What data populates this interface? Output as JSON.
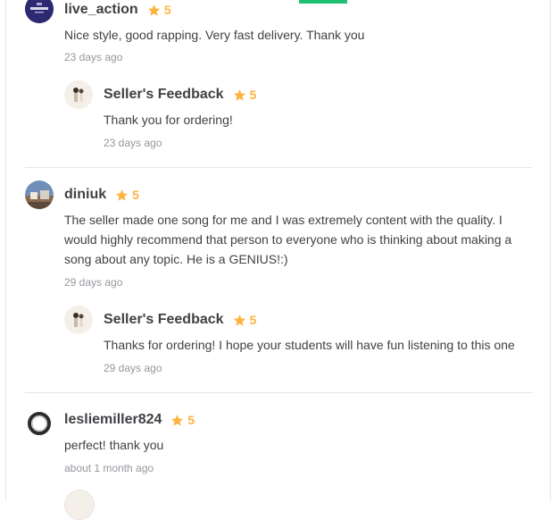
{
  "reviews": [
    {
      "username": "live_action",
      "avatar_text": "LIVE ACTION",
      "rating": "5",
      "text": "Nice style, good rapping. Very fast delivery. Thank you",
      "date": "23 days ago",
      "reply": {
        "title": "Seller's Feedback",
        "rating": "5",
        "text": "Thank you for ordering!",
        "date": "23 days ago"
      }
    },
    {
      "username": "diniuk",
      "rating": "5",
      "text": "The seller made one song for me and I was extremely content with the quality. I would highly recommend that person to everyone who is thinking about making a song about any topic. He is a GENIUS!:)",
      "date": "29 days ago",
      "reply": {
        "title": "Seller's Feedback",
        "rating": "5",
        "text": "Thanks for ordering! I hope your students will have fun listening to this one",
        "date": "29 days ago"
      }
    },
    {
      "username": "lesliemiller824",
      "rating": "5",
      "text": "perfect! thank you",
      "date": "about 1 month ago"
    }
  ],
  "colors": {
    "star": "#ffb33e",
    "accent_tab": "#1dbf73",
    "name": "#404145",
    "muted": "#95979d"
  }
}
